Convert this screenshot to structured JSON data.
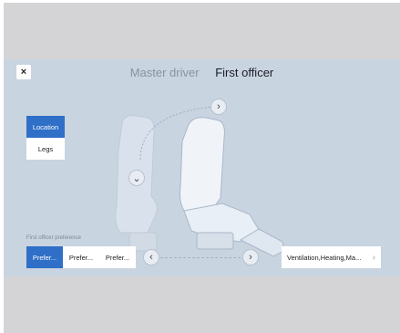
{
  "header": {
    "close_label": "×",
    "tabs": [
      {
        "label": "Master driver",
        "active": false
      },
      {
        "label": "First officer",
        "active": true
      }
    ]
  },
  "side_menu": {
    "items": [
      {
        "label": "Location",
        "selected": true
      },
      {
        "label": "Legs",
        "selected": false
      }
    ]
  },
  "preference": {
    "label": "First officer preference",
    "buttons": [
      {
        "label": "Prefer...",
        "selected": true
      },
      {
        "label": "Prefer...",
        "selected": false
      },
      {
        "label": "Prefer...",
        "selected": false
      }
    ]
  },
  "controls": {
    "prev_glyph": "‹",
    "next_glyph": "›",
    "rotate_glyph": "›",
    "down_glyph": "⌄"
  },
  "features": {
    "label": "Ventilation,Heating,Ma...",
    "chevron": "›"
  },
  "colors": {
    "accent": "#2f6fc7",
    "panel_bg": "#c9d4e1",
    "outer_bg": "#d4d4d6"
  }
}
